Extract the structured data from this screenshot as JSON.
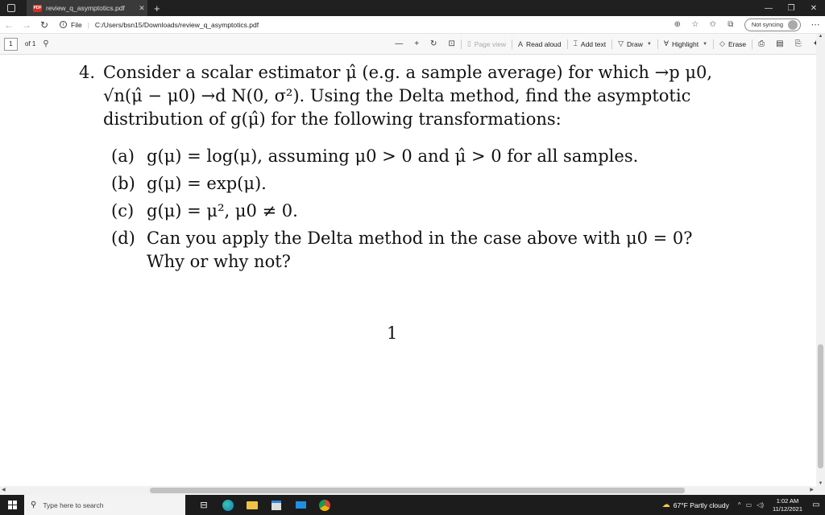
{
  "browser": {
    "tab_title": "review_q_asymptotics.pdf",
    "url_label": "File",
    "url": "C:/Users/bsn15/Downloads/review_q_asymptotics.pdf",
    "sync_label": "Not syncing"
  },
  "pdf_toolbar": {
    "page_current": "1",
    "page_total": "of 1",
    "page_view": "Page view",
    "read_aloud": "Read aloud",
    "add_text": "Add text",
    "draw": "Draw",
    "highlight": "Highlight",
    "erase": "Erase"
  },
  "document": {
    "question_number": "4.",
    "question_line1": "Consider a scalar estimator μ̂ (e.g. a sample average) for which →p μ0,",
    "question_line2": "√n(μ̂ − μ0) →d N(0, σ²). Using the Delta method, find the asymptotic",
    "question_line3": "distribution of g(μ̂) for the following transformations:",
    "parts": [
      {
        "label": "(a)",
        "text": "g(μ) = log(μ), assuming μ0 > 0 and μ̂ > 0 for all samples."
      },
      {
        "label": "(b)",
        "text": "g(μ) = exp(μ)."
      },
      {
        "label": "(c)",
        "text": "g(μ) = μ², μ0 ≠ 0."
      },
      {
        "label": "(d)",
        "text": "Can you apply the Delta method in the case above with μ0 = 0? Why or why not?"
      }
    ],
    "page_number": "1"
  },
  "taskbar": {
    "search_placeholder": "Type here to search",
    "weather": "67°F  Partly cloudy",
    "time": "1:02 AM",
    "date": "11/12/2021"
  }
}
